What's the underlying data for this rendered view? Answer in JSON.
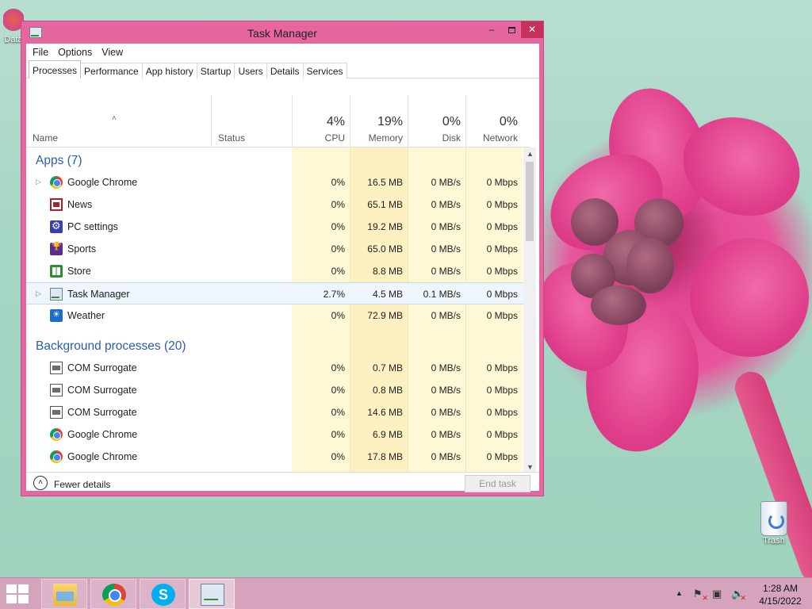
{
  "window": {
    "title": "Task Manager",
    "minimize_glyph": "–",
    "close_glyph": "✕"
  },
  "menu": [
    "File",
    "Options",
    "View"
  ],
  "tabs": [
    "Processes",
    "Performance",
    "App history",
    "Startup",
    "Users",
    "Details",
    "Services"
  ],
  "active_tab": "Processes",
  "header": {
    "sort_arrow": "˄",
    "name": "Name",
    "status": "Status",
    "cpu_pct": "4%",
    "cpu": "CPU",
    "mem_pct": "19%",
    "mem": "Memory",
    "disk_pct": "0%",
    "disk": "Disk",
    "net_pct": "0%",
    "net": "Network"
  },
  "groups": {
    "apps": "Apps (7)",
    "background": "Background processes (20)"
  },
  "apps": [
    {
      "name": "Google Chrome",
      "icon": "chrome-icon",
      "expandable": true,
      "cpu": "0%",
      "mem": "16.5 MB",
      "disk": "0 MB/s",
      "net": "0 Mbps"
    },
    {
      "name": "News",
      "icon": "news-icon",
      "expandable": false,
      "cpu": "0%",
      "mem": "65.1 MB",
      "disk": "0 MB/s",
      "net": "0 Mbps"
    },
    {
      "name": "PC settings",
      "icon": "settings-icon",
      "expandable": false,
      "cpu": "0%",
      "mem": "19.2 MB",
      "disk": "0 MB/s",
      "net": "0 Mbps"
    },
    {
      "name": "Sports",
      "icon": "sports-icon",
      "expandable": false,
      "cpu": "0%",
      "mem": "65.0 MB",
      "disk": "0 MB/s",
      "net": "0 Mbps"
    },
    {
      "name": "Store",
      "icon": "store-icon",
      "expandable": false,
      "cpu": "0%",
      "mem": "8.8 MB",
      "disk": "0 MB/s",
      "net": "0 Mbps"
    },
    {
      "name": "Task Manager",
      "icon": "task-manager-icon",
      "expandable": true,
      "cpu": "2.7%",
      "mem": "4.5 MB",
      "disk": "0.1 MB/s",
      "net": "0 Mbps"
    },
    {
      "name": "Weather",
      "icon": "weather-icon",
      "expandable": false,
      "cpu": "0%",
      "mem": "72.9 MB",
      "disk": "0 MB/s",
      "net": "0 Mbps"
    }
  ],
  "background": [
    {
      "name": "COM Surrogate",
      "icon": "com-surrogate-icon",
      "cpu": "0%",
      "mem": "0.7 MB",
      "disk": "0 MB/s",
      "net": "0 Mbps"
    },
    {
      "name": "COM Surrogate",
      "icon": "com-surrogate-icon",
      "cpu": "0%",
      "mem": "0.8 MB",
      "disk": "0 MB/s",
      "net": "0 Mbps"
    },
    {
      "name": "COM Surrogate",
      "icon": "com-surrogate-icon",
      "cpu": "0%",
      "mem": "14.6 MB",
      "disk": "0 MB/s",
      "net": "0 Mbps"
    },
    {
      "name": "Google Chrome",
      "icon": "chrome-icon",
      "cpu": "0%",
      "mem": "6.9 MB",
      "disk": "0 MB/s",
      "net": "0 Mbps"
    },
    {
      "name": "Google Chrome",
      "icon": "chrome-icon",
      "cpu": "0%",
      "mem": "17.8 MB",
      "disk": "0 MB/s",
      "net": "0 Mbps"
    }
  ],
  "footer": {
    "fewer_details": "Fewer details",
    "end_task": "End task"
  },
  "desktop": {
    "trash_label": "Trash",
    "left_icon_label": "Data"
  },
  "taskbar": {
    "time": "1:28 AM",
    "date": "4/15/2022",
    "skype_glyph": "S",
    "tray_up": "▲",
    "tray_flag": "⚑",
    "tray_net": "▣",
    "tray_vol": "🔈"
  },
  "colors": {
    "window_frame": "#e6669f",
    "group_header": "#2b5ea8",
    "close_button": "#c7315a",
    "cpu_heat": "#fff8d6",
    "memory_heat": "#fdf1c1",
    "taskbar": "#d6a3bd"
  }
}
